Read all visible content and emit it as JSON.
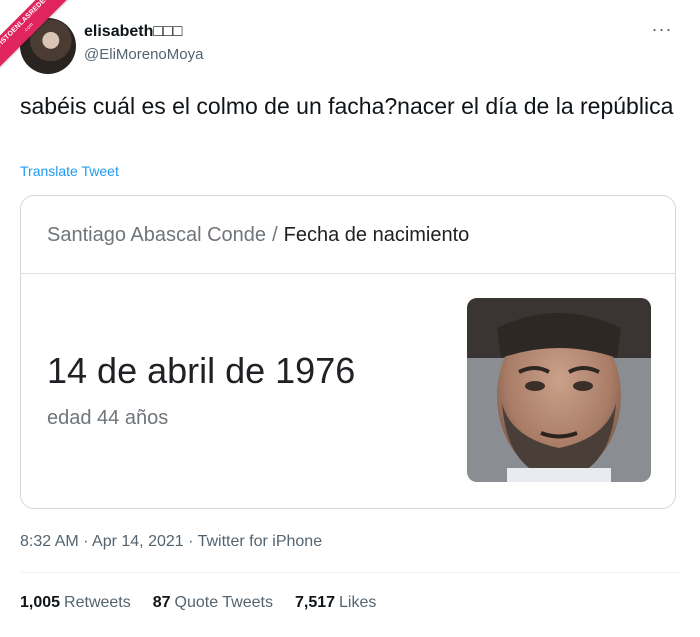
{
  "watermark": {
    "line1": "VISTOENLASREDES",
    "line2": ".com"
  },
  "tweet": {
    "display_name": "elisabeth□□□",
    "handle": "@EliMorenoMoya",
    "text": "sabéis cuál es el colmo de un facha?nacer el día de la república",
    "translate_label": "Translate Tweet",
    "timestamp": "8:32 AM · Apr 14, 2021 · Twitter for iPhone"
  },
  "card": {
    "breadcrumb_entity": "Santiago Abascal Conde",
    "breadcrumb_separator": "/",
    "breadcrumb_attribute": "Fecha de nacimiento",
    "date": "14 de abril de 1976",
    "age": "edad 44 años"
  },
  "stats": [
    {
      "count": "1,005",
      "label": "Retweets"
    },
    {
      "count": "87",
      "label": "Quote Tweets"
    },
    {
      "count": "7,517",
      "label": "Likes"
    }
  ],
  "colors": {
    "link": "#1d9bf0",
    "muted": "#536471",
    "ribbon": "#e0245e"
  },
  "icons": {
    "more": "more-horizontal-icon"
  }
}
